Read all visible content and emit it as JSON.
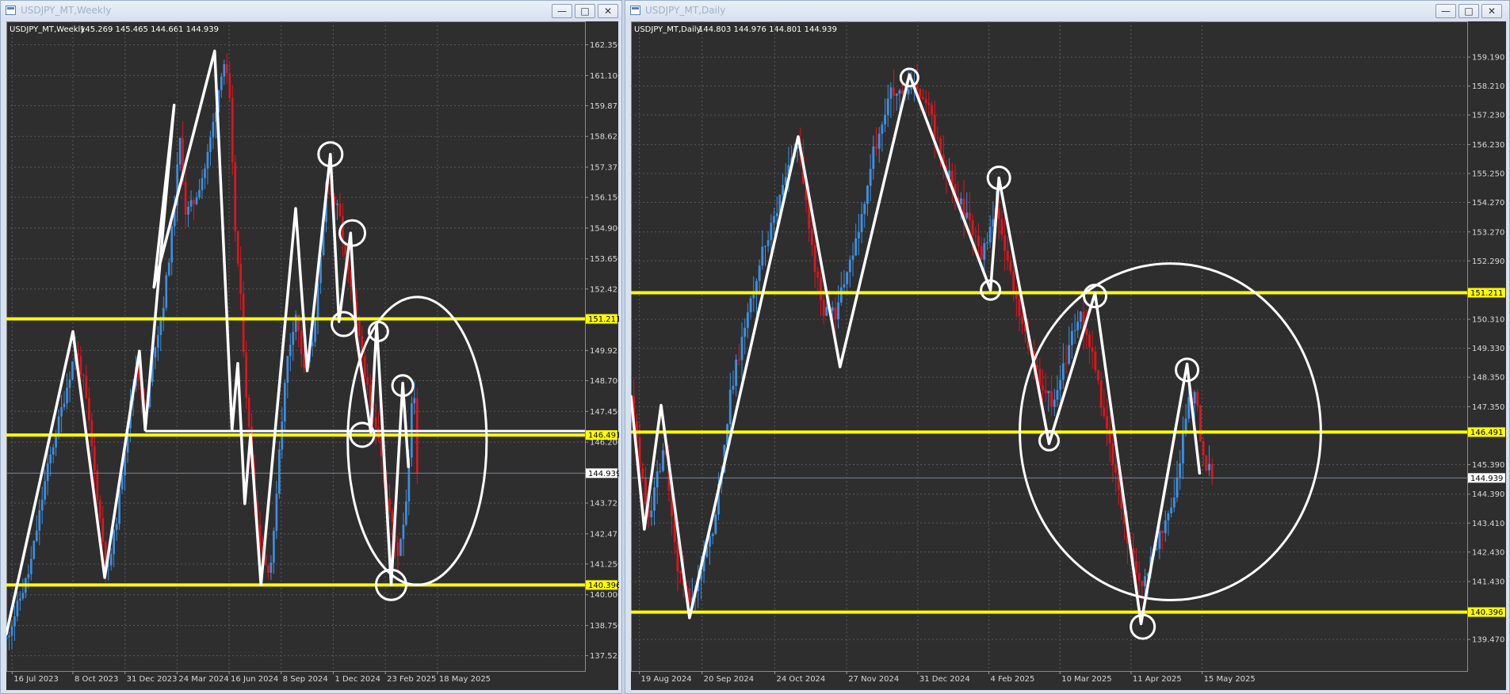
{
  "colors": {
    "background": "#2e2e2e",
    "bull": "#3d8fe0",
    "bear": "#e0141e",
    "level": "#ffff00",
    "annotation": "#ffffff",
    "grid": "#5a5a5a",
    "axis_text": "#d8d8d8"
  },
  "windows": [
    {
      "id": "weekly",
      "title": "USDJPY_MT,Weekly"
    },
    {
      "id": "daily",
      "title": "USDJPY_MT,Daily"
    }
  ],
  "chart_data": [
    {
      "type": "candlestick",
      "title": "USDJPY_MT,Weekly",
      "ohlc_label": "145.269 145.465 144.661 144.939",
      "ylim": [
        136.9,
        163.3
      ],
      "y_ticks": [
        162.35,
        161.1,
        159.875,
        158.625,
        157.375,
        156.15,
        154.9,
        153.65,
        152.425,
        149.925,
        148.7,
        147.45,
        146.2,
        143.725,
        142.475,
        141.25,
        140.0,
        138.75,
        137.525
      ],
      "x_labels": [
        {
          "label": "16 Jul 2023",
          "x": 0.01
        },
        {
          "label": "8 Oct 2023",
          "x": 0.115
        },
        {
          "label": "31 Dec 2023",
          "x": 0.205
        },
        {
          "label": "24 Mar 2024",
          "x": 0.295
        },
        {
          "label": "16 Jun 2024",
          "x": 0.385
        },
        {
          "label": "8 Sep 2024",
          "x": 0.475
        },
        {
          "label": "1 Dec 2024",
          "x": 0.565
        },
        {
          "label": "23 Feb 2025",
          "x": 0.655
        },
        {
          "label": "18 May 2025",
          "x": 0.745
        }
      ],
      "current_price": 144.939,
      "levels": [
        151.211,
        146.491,
        140.396
      ],
      "level_labels": [
        "151.211",
        "146.491",
        "140.396"
      ],
      "extra_line": {
        "price": 146.65,
        "x_start": 0.24,
        "x_end": 1.0
      },
      "price_path": [
        [
          0.0,
          138.2
        ],
        [
          0.04,
          141.0
        ],
        [
          0.07,
          145.0
        ],
        [
          0.1,
          148.0
        ],
        [
          0.12,
          150.0
        ],
        [
          0.135,
          148.5
        ],
        [
          0.15,
          145.5
        ],
        [
          0.165,
          142.5
        ],
        [
          0.175,
          140.8
        ],
        [
          0.19,
          143.0
        ],
        [
          0.21,
          147.0
        ],
        [
          0.225,
          149.5
        ],
        [
          0.24,
          147.0
        ],
        [
          0.255,
          150.0
        ],
        [
          0.27,
          151.5
        ],
        [
          0.285,
          154.5
        ],
        [
          0.3,
          158.5
        ],
        [
          0.31,
          155.5
        ],
        [
          0.325,
          156.0
        ],
        [
          0.345,
          157.5
        ],
        [
          0.36,
          159.5
        ],
        [
          0.375,
          161.8
        ],
        [
          0.385,
          160.5
        ],
        [
          0.395,
          155.0
        ],
        [
          0.405,
          152.0
        ],
        [
          0.415,
          148.0
        ],
        [
          0.425,
          145.0
        ],
        [
          0.435,
          142.5
        ],
        [
          0.45,
          141.0
        ],
        [
          0.46,
          141.5
        ],
        [
          0.47,
          145.5
        ],
        [
          0.485,
          149.5
        ],
        [
          0.5,
          151.5
        ],
        [
          0.515,
          149.0
        ],
        [
          0.53,
          150.5
        ],
        [
          0.545,
          154.0
        ],
        [
          0.555,
          157.5
        ],
        [
          0.56,
          156.3
        ],
        [
          0.575,
          155.5
        ],
        [
          0.585,
          153.8
        ],
        [
          0.595,
          152.5
        ],
        [
          0.605,
          151.0
        ],
        [
          0.62,
          149.0
        ],
        [
          0.63,
          147.3
        ],
        [
          0.645,
          146.5
        ],
        [
          0.655,
          144.2
        ],
        [
          0.67,
          142.5
        ],
        [
          0.675,
          141.5
        ],
        [
          0.69,
          143.5
        ],
        [
          0.7,
          147.5
        ],
        [
          0.705,
          148.3
        ],
        [
          0.71,
          145.0
        ]
      ],
      "annotation_path": [
        [
          0.0,
          138.4
        ],
        [
          0.115,
          150.7
        ],
        [
          0.17,
          140.7
        ],
        [
          0.23,
          149.9
        ],
        [
          0.24,
          146.7
        ],
        [
          0.29,
          159.9
        ],
        [
          0.255,
          152.5
        ],
        [
          0.36,
          162.1
        ],
        [
          0.39,
          146.7
        ],
        [
          0.4,
          149.4
        ],
        [
          0.412,
          143.7
        ],
        [
          0.422,
          146.5
        ],
        [
          0.44,
          140.4
        ],
        [
          0.5,
          155.7
        ],
        [
          0.52,
          149.1
        ],
        [
          0.56,
          157.9
        ],
        [
          0.575,
          151.1
        ],
        [
          0.595,
          154.7
        ],
        [
          0.605,
          150.5
        ],
        [
          0.63,
          146.6
        ],
        [
          0.64,
          151.0
        ],
        [
          0.665,
          140.4
        ],
        [
          0.685,
          148.6
        ],
        [
          0.695,
          145.2
        ]
      ],
      "circles": [
        [
          0.56,
          157.9,
          15
        ],
        [
          0.598,
          154.7,
          16
        ],
        [
          0.583,
          151.0,
          15
        ],
        [
          0.643,
          150.7,
          12
        ],
        [
          0.615,
          146.5,
          15
        ],
        [
          0.685,
          148.5,
          13
        ],
        [
          0.665,
          140.4,
          19
        ]
      ],
      "ellipse": [
        0.71,
        146.25,
        0.12,
        11.7
      ]
    },
    {
      "type": "candlestick",
      "title": "USDJPY_MT,Daily",
      "ohlc_label": "144.803 144.976 144.801 144.939",
      "ylim": [
        138.4,
        160.4
      ],
      "y_ticks": [
        159.19,
        158.21,
        157.23,
        156.23,
        155.25,
        154.27,
        153.27,
        152.29,
        150.31,
        149.33,
        148.35,
        147.35,
        145.39,
        144.39,
        143.41,
        142.43,
        141.43,
        139.47
      ],
      "x_labels": [
        {
          "label": "19 Aug 2024",
          "x": 0.01
        },
        {
          "label": "20 Sep 2024",
          "x": 0.085
        },
        {
          "label": "24 Oct 2024",
          "x": 0.172
        },
        {
          "label": "27 Nov 2024",
          "x": 0.258
        },
        {
          "label": "31 Dec 2024",
          "x": 0.343
        },
        {
          "label": "4 Feb 2025",
          "x": 0.428
        },
        {
          "label": "10 Mar 2025",
          "x": 0.513
        },
        {
          "label": "11 Apr 2025",
          "x": 0.598
        },
        {
          "label": "15 May 2025",
          "x": 0.683
        }
      ],
      "current_price": 144.939,
      "levels": [
        151.211,
        146.491,
        140.396
      ],
      "level_labels": [
        "151.211",
        "146.491",
        "140.396"
      ],
      "price_path": [
        [
          0.0,
          147.5
        ],
        [
          0.02,
          143.5
        ],
        [
          0.04,
          146.0
        ],
        [
          0.055,
          142.0
        ],
        [
          0.07,
          140.8
        ],
        [
          0.085,
          141.8
        ],
        [
          0.1,
          143.5
        ],
        [
          0.12,
          148.0
        ],
        [
          0.14,
          150.5
        ],
        [
          0.155,
          152.5
        ],
        [
          0.17,
          153.5
        ],
        [
          0.185,
          155.0
        ],
        [
          0.2,
          156.5
        ],
        [
          0.215,
          153.0
        ],
        [
          0.23,
          150.5
        ],
        [
          0.245,
          150.5
        ],
        [
          0.26,
          152.0
        ],
        [
          0.275,
          153.5
        ],
        [
          0.29,
          156.0
        ],
        [
          0.31,
          158.0
        ],
        [
          0.325,
          157.8
        ],
        [
          0.34,
          158.2
        ],
        [
          0.355,
          157.5
        ],
        [
          0.375,
          155.5
        ],
        [
          0.39,
          154.5
        ],
        [
          0.405,
          153.5
        ],
        [
          0.42,
          152.5
        ],
        [
          0.435,
          154.0
        ],
        [
          0.445,
          153.0
        ],
        [
          0.46,
          151.0
        ],
        [
          0.475,
          149.5
        ],
        [
          0.49,
          148.0
        ],
        [
          0.505,
          147.5
        ],
        [
          0.52,
          149.0
        ],
        [
          0.535,
          150.5
        ],
        [
          0.545,
          150.0
        ],
        [
          0.555,
          148.5
        ],
        [
          0.57,
          146.5
        ],
        [
          0.585,
          144.0
        ],
        [
          0.6,
          142.0
        ],
        [
          0.61,
          141.0
        ],
        [
          0.625,
          142.5
        ],
        [
          0.64,
          143.5
        ],
        [
          0.655,
          145.0
        ],
        [
          0.665,
          147.5
        ],
        [
          0.675,
          147.8
        ],
        [
          0.685,
          145.5
        ],
        [
          0.695,
          145.0
        ]
      ],
      "annotation_path": [
        [
          0.0,
          147.7
        ],
        [
          0.016,
          143.2
        ],
        [
          0.036,
          147.4
        ],
        [
          0.07,
          140.2
        ],
        [
          0.2,
          156.5
        ],
        [
          0.25,
          148.7
        ],
        [
          0.333,
          158.6
        ],
        [
          0.43,
          151.3
        ],
        [
          0.44,
          155.1
        ],
        [
          0.5,
          146.1
        ],
        [
          0.555,
          151.2
        ],
        [
          0.61,
          140.0
        ],
        [
          0.665,
          148.8
        ],
        [
          0.68,
          145.1
        ]
      ],
      "circles": [
        [
          0.333,
          158.5,
          11
        ],
        [
          0.44,
          155.1,
          14
        ],
        [
          0.43,
          151.3,
          12
        ],
        [
          0.555,
          151.1,
          14
        ],
        [
          0.5,
          146.2,
          12
        ],
        [
          0.665,
          148.6,
          14
        ],
        [
          0.612,
          139.9,
          15
        ]
      ],
      "ellipse": [
        0.645,
        146.5,
        0.18,
        11.4
      ]
    }
  ]
}
